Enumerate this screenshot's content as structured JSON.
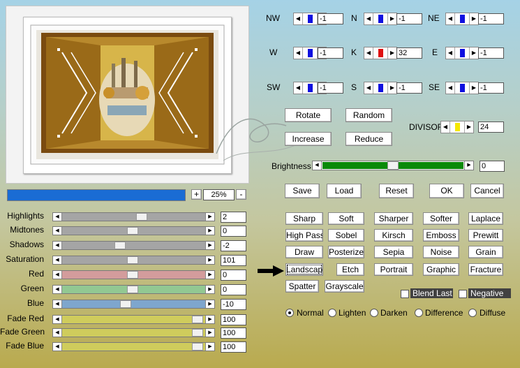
{
  "colors": {
    "thumb_blue": "#1010e0",
    "thumb_red": "#e01010",
    "thumb_yellow": "#f5e800",
    "progress_blue": "#1a6cd4",
    "brightness_green": "#0a8a0a"
  },
  "matrix": {
    "nw": {
      "label": "NW",
      "value": "-1"
    },
    "n": {
      "label": "N",
      "value": "-1"
    },
    "ne": {
      "label": "NE",
      "value": "-1"
    },
    "w": {
      "label": "W",
      "value": "-1"
    },
    "k": {
      "label": "K",
      "value": "32"
    },
    "e": {
      "label": "E",
      "value": "-1"
    },
    "sw": {
      "label": "SW",
      "value": "-1"
    },
    "s": {
      "label": "S",
      "value": "-1"
    },
    "se": {
      "label": "SE",
      "value": "-1"
    }
  },
  "controls": {
    "rotate": "Rotate",
    "random": "Random",
    "increase": "Increase",
    "reduce": "Reduce",
    "divisor_label": "DIVISOR",
    "divisor_value": "24",
    "brightness_label": "Brightness",
    "brightness_value": "0",
    "save": "Save",
    "load": "Load",
    "reset": "Reset",
    "ok": "OK",
    "cancel": "Cancel"
  },
  "zoom": {
    "plus": "+",
    "minus": "-",
    "value": "25%",
    "progress_level": 1.0
  },
  "sliders": [
    {
      "label": "Highlights",
      "value": "2",
      "level": 0.56,
      "color": "#a5a5a5"
    },
    {
      "label": "Midtones",
      "value": "0",
      "level": 0.49,
      "color": "#a5a5a5"
    },
    {
      "label": "Shadows",
      "value": "-2",
      "level": 0.4,
      "color": "#a5a5a5"
    },
    {
      "label": "Saturation",
      "value": "101",
      "level": 0.49,
      "color": "#a5a5a5"
    },
    {
      "label": "Red",
      "value": "0",
      "level": 0.49,
      "color": "#d39c9c"
    },
    {
      "label": "Green",
      "value": "0",
      "level": 0.49,
      "color": "#92c892"
    },
    {
      "label": "Blue",
      "value": "-10",
      "level": 0.44,
      "color": "#7ea6cd"
    },
    {
      "label": "Fade Red",
      "value": "100",
      "level": 0.98,
      "color": "#cfcc5c"
    },
    {
      "label": "Fade Green",
      "value": "100",
      "level": 0.98,
      "color": "#cfcc5c"
    },
    {
      "label": "Fade Blue",
      "value": "100",
      "level": 0.98,
      "color": "#cfcc5c"
    }
  ],
  "presets": [
    [
      "Sharp",
      "Soft",
      "Sharper",
      "Softer",
      "Laplace"
    ],
    [
      "High Pass",
      "Sobel",
      "Kirsch",
      "Emboss",
      "Prewitt"
    ],
    [
      "Draw",
      "Posterize",
      "Sepia",
      "Noise",
      "Grain"
    ],
    [
      "Landscape",
      "Etch",
      "Portrait",
      "Graphic",
      "Fracture"
    ],
    [
      "Spatter",
      "Grayscale"
    ]
  ],
  "options": {
    "blend_last": "Blend Last",
    "negative": "Negative"
  },
  "modes": {
    "selected": "Normal",
    "items": [
      "Normal",
      "Lighten",
      "Darken",
      "Difference",
      "Diffuse"
    ]
  }
}
